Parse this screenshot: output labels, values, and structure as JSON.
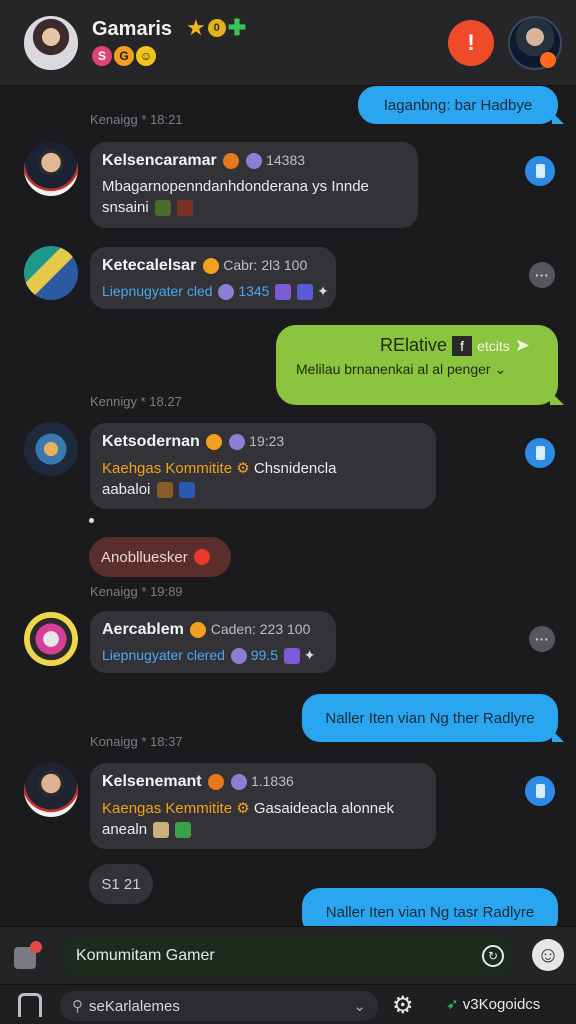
{
  "header": {
    "title": "Gamaris",
    "badge_coin": "0",
    "sub_badge_1": "S",
    "sub_badge_2": "G",
    "alert_glyph": "!"
  },
  "messages": {
    "out_1": "Iaganbng: bar Hadbye",
    "ts_1": "Kenaigg * 18:21",
    "card_1": {
      "name": "Kelsencaramar",
      "meta": "14383",
      "line_1": "Mbagarnopenndanhdonderana ys Innde",
      "line_2": "snsaini"
    },
    "card_2": {
      "name": "Ketecalelsar",
      "meta": "Cabr: 2l3 100",
      "line_1": "Liepnugyater cled",
      "line_1_value": "1345"
    },
    "green": {
      "title": "RElative",
      "title_suffix": "etcits",
      "line": "Melilau brnanenkai al al penger"
    },
    "ts_2": "Kennigy * 18.27",
    "card_3": {
      "name": "Ketsodernan",
      "meta": "19:23",
      "line_1_orange": "Kaehgas Kommitite",
      "line_1_rest": "Chsnidencla",
      "line_2": "aabaloi"
    },
    "pill_red": "Anoblluesker",
    "ts_3": "Kenaigg * 19:89",
    "card_4": {
      "name": "Aercablem",
      "meta": "Caden: 223 100",
      "line_1": "Liepnugyater clered",
      "line_1_value": "99.5"
    },
    "out_2": "Naller Iten vian Ng ther Radlyre",
    "ts_4": "Konaigg * 18:37",
    "card_5": {
      "name": "Kelsenemant",
      "meta": "1.1836",
      "line_1_orange": "Kaengas Kemmitite",
      "line_1_rest": "Gasaideacla alonnek",
      "line_2": "anealn"
    },
    "pill_grey": "S1 21",
    "out_3": "Naller Iten vian Ng tasr Radlyre"
  },
  "composer": {
    "input_value": "Komumitam Gamer"
  },
  "bottom": {
    "search_value": "seKarlalemes",
    "brand": "v3Kogoidcs"
  },
  "colors": {
    "bg": "#1b1b1d",
    "out_blue": "#2aa6f0",
    "green": "#8bc43e",
    "accent_red": "#ef4b2b",
    "orange": "#f2a11e"
  }
}
